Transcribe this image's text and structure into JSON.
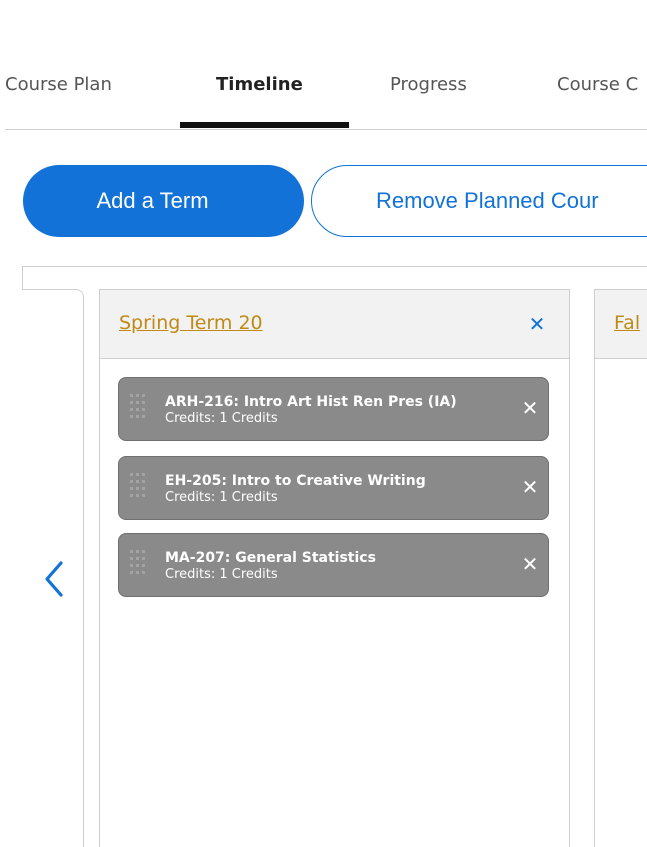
{
  "tabs": [
    {
      "label": "Course Plan",
      "active": false
    },
    {
      "label": "Timeline",
      "active": true
    },
    {
      "label": "Progress",
      "active": false
    },
    {
      "label": "Course C",
      "active": false
    }
  ],
  "actions": {
    "add_term_label": "Add a Term",
    "remove_planned_label": "Remove Planned Cour"
  },
  "timeline": {
    "prev_icon": "chevron-left-icon",
    "terms": [
      {
        "title": "Spring Term 20",
        "close_icon": "close-icon",
        "courses": [
          {
            "name": "ARH-216: Intro Art Hist Ren Pres (IA)",
            "credits": "Credits: 1 Credits"
          },
          {
            "name": "EH-205: Intro to Creative Writing",
            "credits": "Credits: 1 Credits"
          },
          {
            "name": "MA-207: General Statistics",
            "credits": "Credits: 1 Credits"
          }
        ]
      },
      {
        "title": "Fal"
      }
    ]
  },
  "colors": {
    "accent": "#1272d8",
    "term_link": "#c08a17",
    "chip": "#8a8a8a"
  }
}
